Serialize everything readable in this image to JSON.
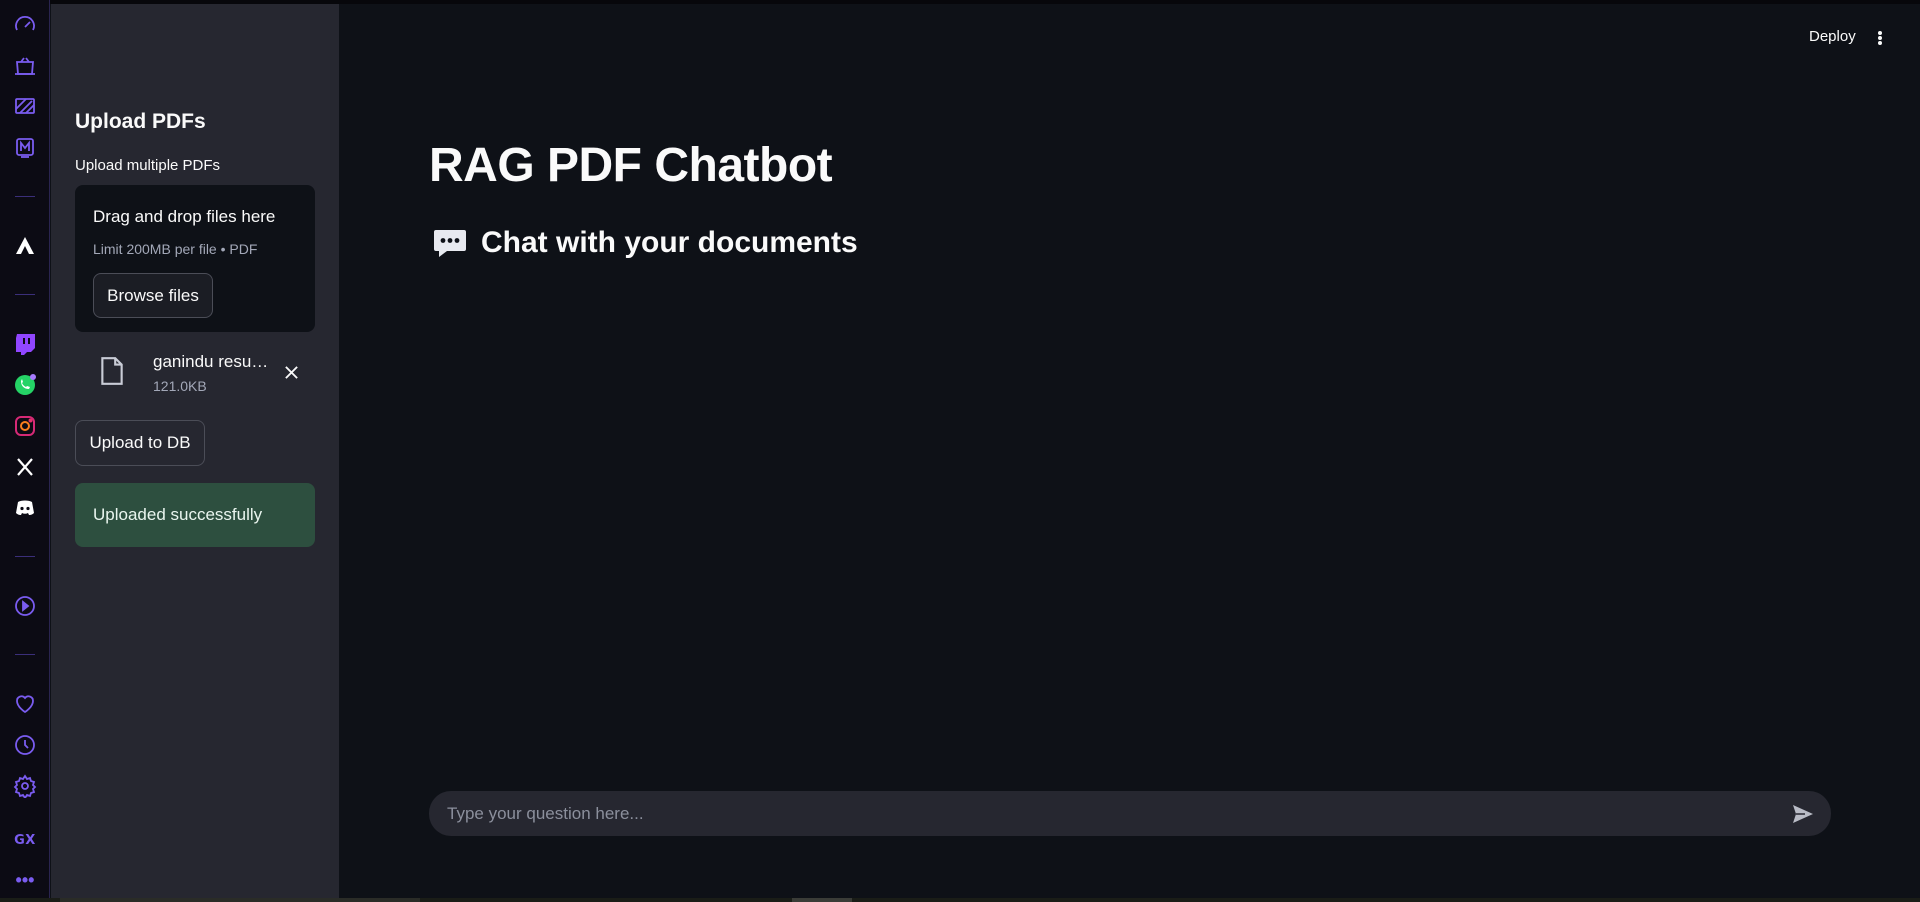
{
  "browser_rail": {
    "icons": [
      "speed-dial-icon",
      "shopping-icon",
      "wallet-icon",
      "player-icon",
      "aria-icon",
      "twitch-icon",
      "whatsapp-icon",
      "instagram-icon",
      "x-icon",
      "discord-icon",
      "video-player-icon",
      "favorites-icon",
      "history-icon",
      "settings-icon",
      "gx-logo",
      "more-icon"
    ],
    "gx_label": "GX",
    "more_label": "•••"
  },
  "sidebar": {
    "title": "Upload PDFs",
    "uploader_label": "Upload multiple PDFs",
    "dropzone": {
      "title": "Drag and drop files here",
      "limit_text": "Limit 200MB per file • PDF",
      "browse_label": "Browse files"
    },
    "files": [
      {
        "name": "ganindu resu…",
        "size": "121.0KB"
      }
    ],
    "upload_button_label": "Upload to DB",
    "status_message": "Uploaded successfully"
  },
  "header": {
    "deploy_label": "Deploy"
  },
  "main": {
    "title": "RAG PDF Chatbot",
    "subheader": "Chat with your documents",
    "chat_input_placeholder": "Type your question here..."
  },
  "colors": {
    "background": "#0e1117",
    "sidebar": "#262730",
    "success": "#2d4f3f",
    "accent_rail": "#7a5cf0"
  }
}
